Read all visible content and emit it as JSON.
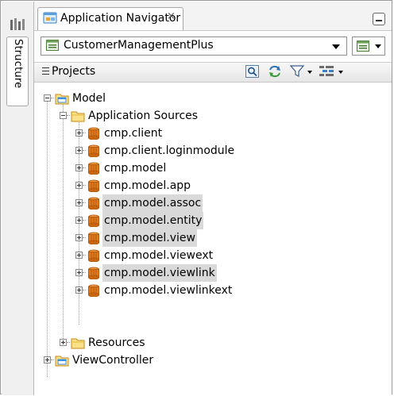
{
  "side_panel": {
    "tab_label": "Structure",
    "icon": "structure-icon"
  },
  "navigator": {
    "tab_title": "Application Navigator",
    "close_glyph": "×",
    "application": "CustomerManagementPlus",
    "projects_label": "Projects"
  },
  "tree": {
    "model": {
      "label": "Model",
      "expanded": true
    },
    "app_sources": {
      "label": "Application Sources",
      "expanded": true
    },
    "packages": [
      {
        "label": "cmp.client",
        "selected": false
      },
      {
        "label": "cmp.client.loginmodule",
        "selected": false
      },
      {
        "label": "cmp.model",
        "selected": false
      },
      {
        "label": "cmp.model.app",
        "selected": false
      },
      {
        "label": "cmp.model.assoc",
        "selected": true
      },
      {
        "label": "cmp.model.entity",
        "selected": true
      },
      {
        "label": "cmp.model.view",
        "selected": true
      },
      {
        "label": "cmp.model.viewext",
        "selected": false
      },
      {
        "label": "cmp.model.viewlink",
        "selected": true
      },
      {
        "label": "cmp.model.viewlinkext",
        "selected": false
      }
    ],
    "resources": {
      "label": "Resources",
      "expanded": false
    },
    "viewcontroller": {
      "label": "ViewController",
      "expanded": false
    }
  },
  "colors": {
    "selection": "#d9d9d9",
    "folder": "#f2cf5a",
    "project": "#3a8ee6",
    "package": "#e07a1f"
  }
}
